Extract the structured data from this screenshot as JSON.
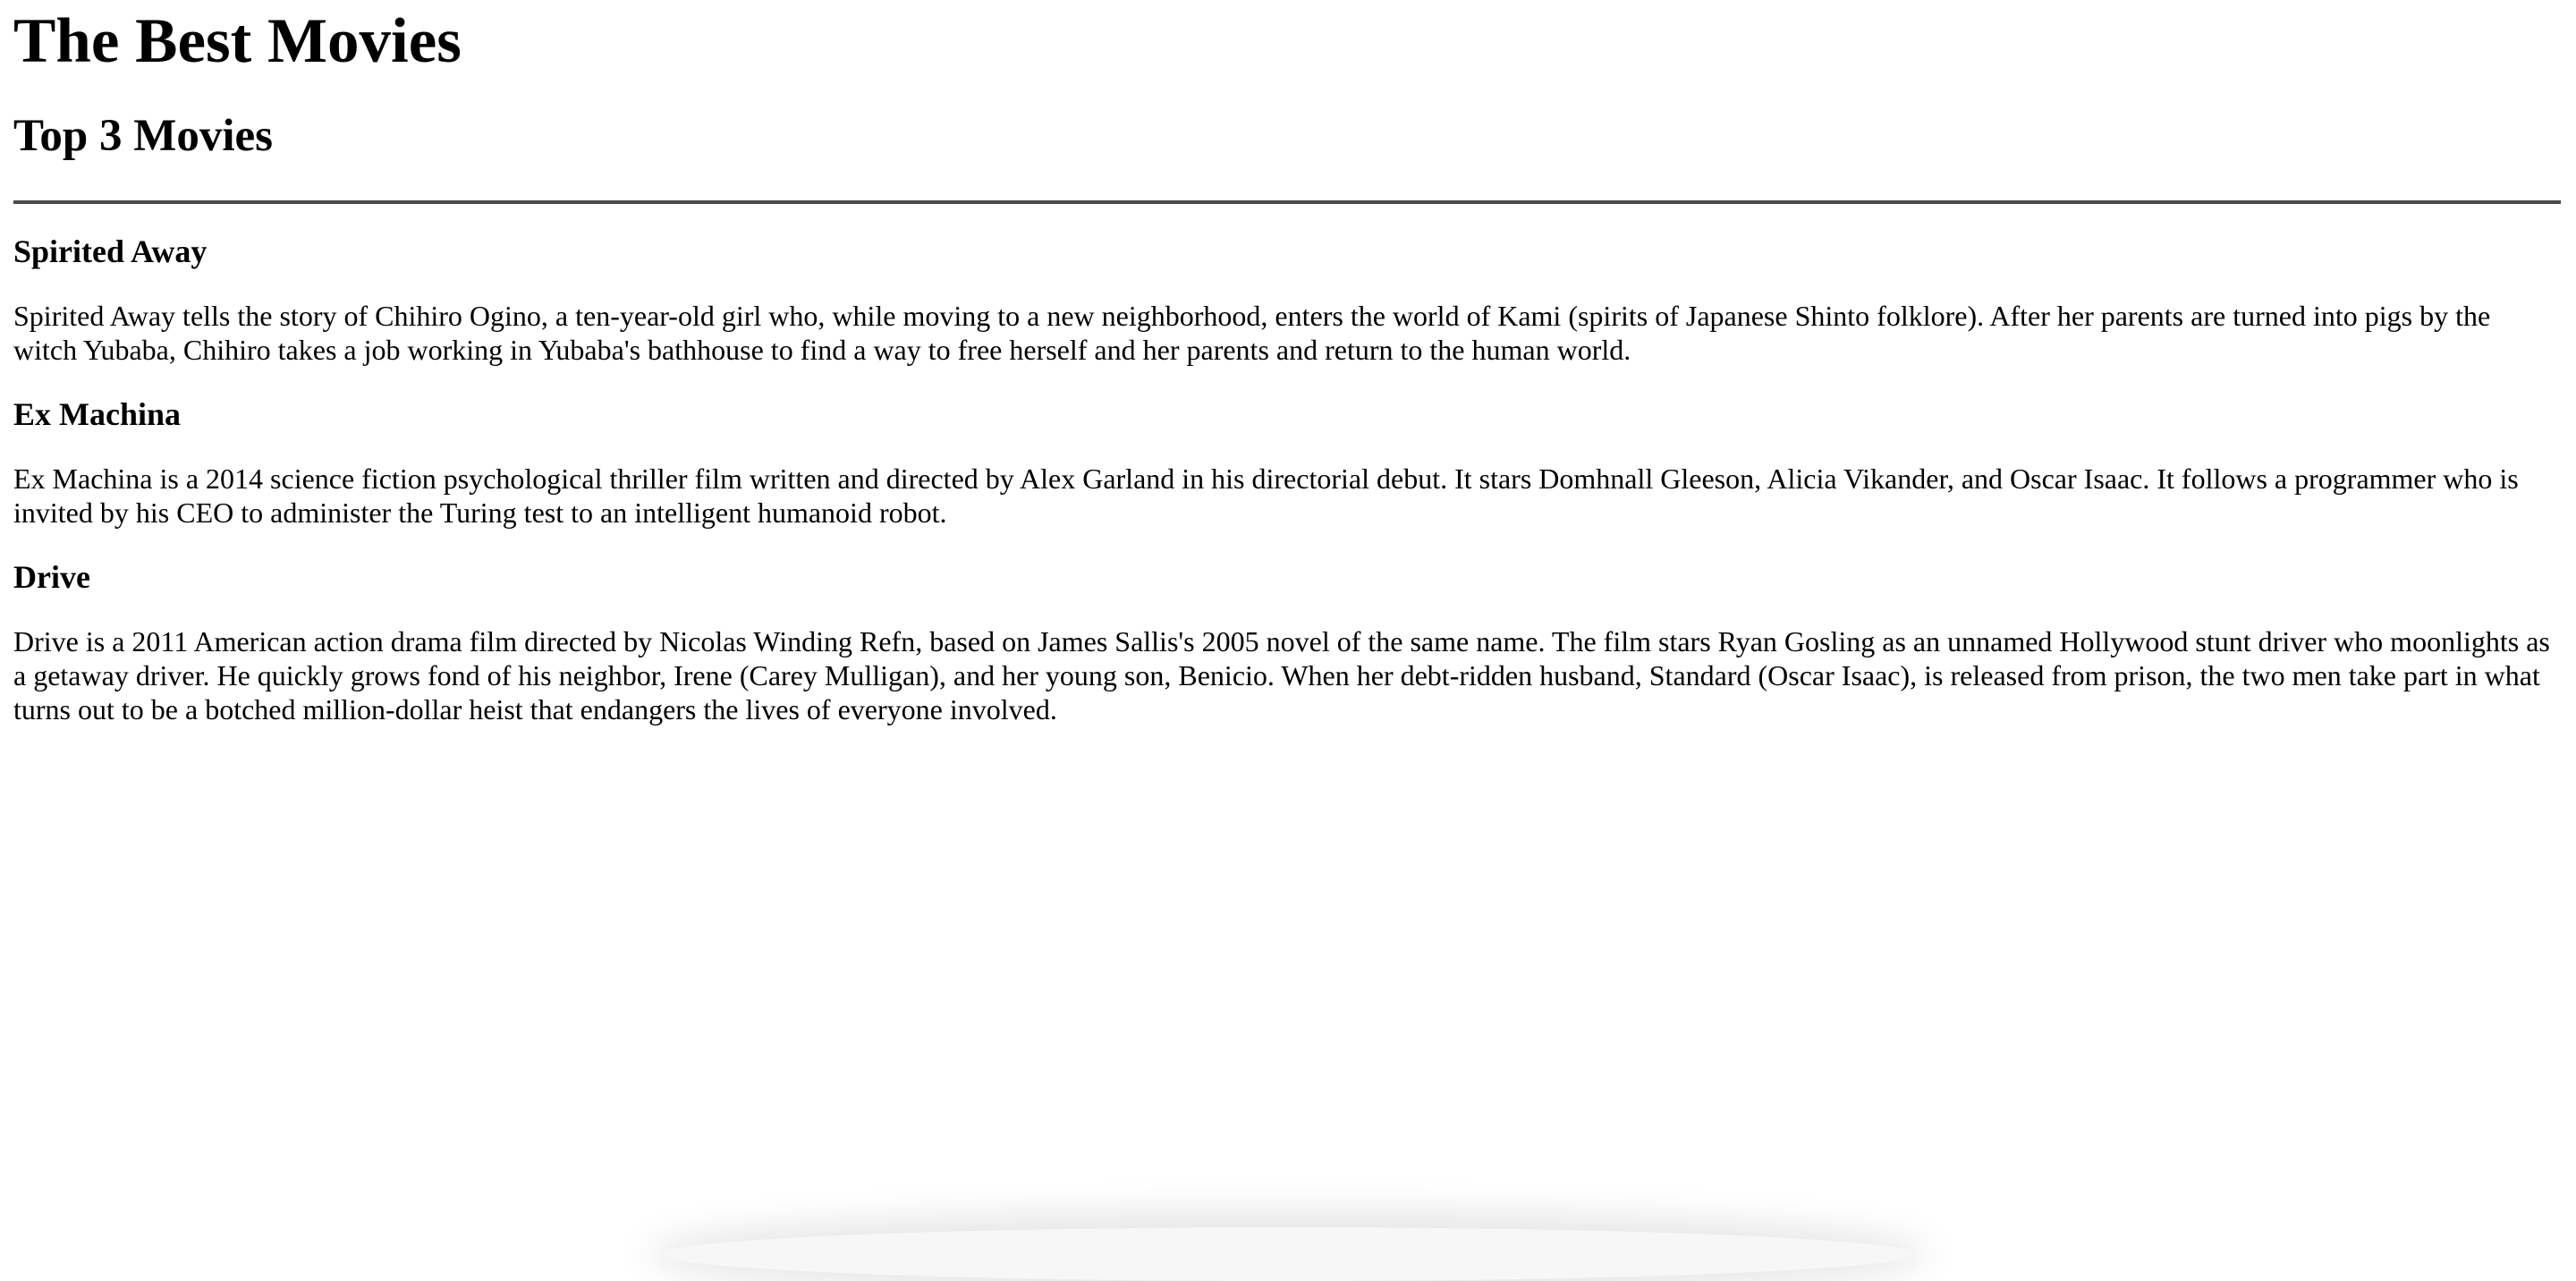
{
  "page": {
    "title": "The Best Movies",
    "section_title": "Top 3 Movies"
  },
  "movies": [
    {
      "title": "Spirited Away",
      "description": "Spirited Away tells the story of Chihiro Ogino, a ten-year-old girl who, while moving to a new neighborhood, enters the world of Kami (spirits of Japanese Shinto folklore). After her parents are turned into pigs by the witch Yubaba, Chihiro takes a job working in Yubaba's bathhouse to find a way to free herself and her parents and return to the human world."
    },
    {
      "title": "Ex Machina",
      "description": "Ex Machina is a 2014 science fiction psychological thriller film written and directed by Alex Garland in his directorial debut. It stars Domhnall Gleeson, Alicia Vikander, and Oscar Isaac. It follows a programmer who is invited by his CEO to administer the Turing test to an intelligent humanoid robot."
    },
    {
      "title": "Drive",
      "description": "Drive is a 2011 American action drama film directed by Nicolas Winding Refn, based on James Sallis's 2005 novel of the same name. The film stars Ryan Gosling as an unnamed Hollywood stunt driver who moonlights as a getaway driver. He quickly grows fond of his neighbor, Irene (Carey Mulligan), and her young son, Benicio. When her debt-ridden husband, Standard (Oscar Isaac), is released from prison, the two men take part in what turns out to be a botched million-dollar heist that endangers the lives of everyone involved."
    }
  ]
}
